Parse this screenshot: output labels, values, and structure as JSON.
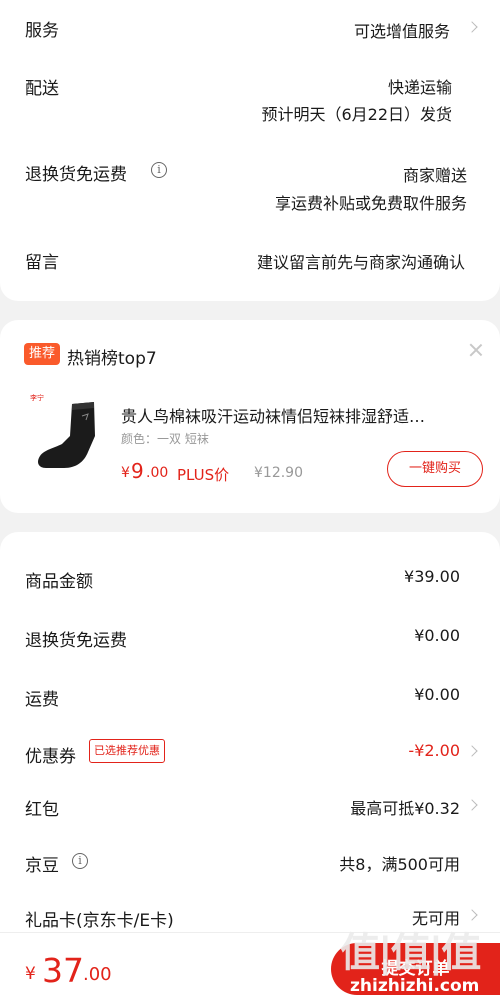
{
  "order": {
    "service": {
      "label": "服务",
      "value": "可选增值服务"
    },
    "delivery": {
      "label": "配送",
      "value": "快递运输",
      "sub": "预计明天（6月22日）发货"
    },
    "return_free": {
      "label": "退换货免运费",
      "value": "商家赠送",
      "sub": "享运费补贴或免费取件服务"
    },
    "message": {
      "label": "留言",
      "placeholder": "建议留言前先与商家沟通确认"
    }
  },
  "recommend": {
    "tag": "推荐",
    "title": "热销榜top7",
    "product": {
      "brand_logo": "李宁",
      "name": "贵人鸟棉袜吸汗运动袜情侣短袜排湿舒适…",
      "spec": "颜色：一双  短袜",
      "currency": "¥",
      "price_int": "9",
      "price_dec": ".00",
      "plus_label": "PLUS价",
      "orig_price": "¥12.90",
      "buy_label": "一键购买"
    }
  },
  "summary": {
    "goods_amount": {
      "label": "商品金额",
      "value": "¥39.00"
    },
    "return_fee": {
      "label": "退换货免运费",
      "value": "¥0.00"
    },
    "shipping": {
      "label": "运费",
      "value": "¥0.00"
    },
    "coupon": {
      "label": "优惠券",
      "tag": "已选推荐优惠",
      "value": "-¥2.00"
    },
    "redpacket": {
      "label": "红包",
      "value": "最高可抵¥0.32"
    },
    "jingdou": {
      "label": "京豆",
      "value": "共8，满500可用"
    },
    "giftcard": {
      "label": "礼品卡(京东卡/E卡)",
      "value": "无可用"
    }
  },
  "footer": {
    "currency": "¥",
    "total_int": "37",
    "total_dec": ".00",
    "submit_label": "提交订单"
  },
  "watermark": {
    "logo": "值|值|值",
    "site": "zhizhizhi.com"
  },
  "colors": {
    "accent": "#e2231a",
    "tag": "#fa5a2b",
    "background": "#f2f2f2"
  }
}
